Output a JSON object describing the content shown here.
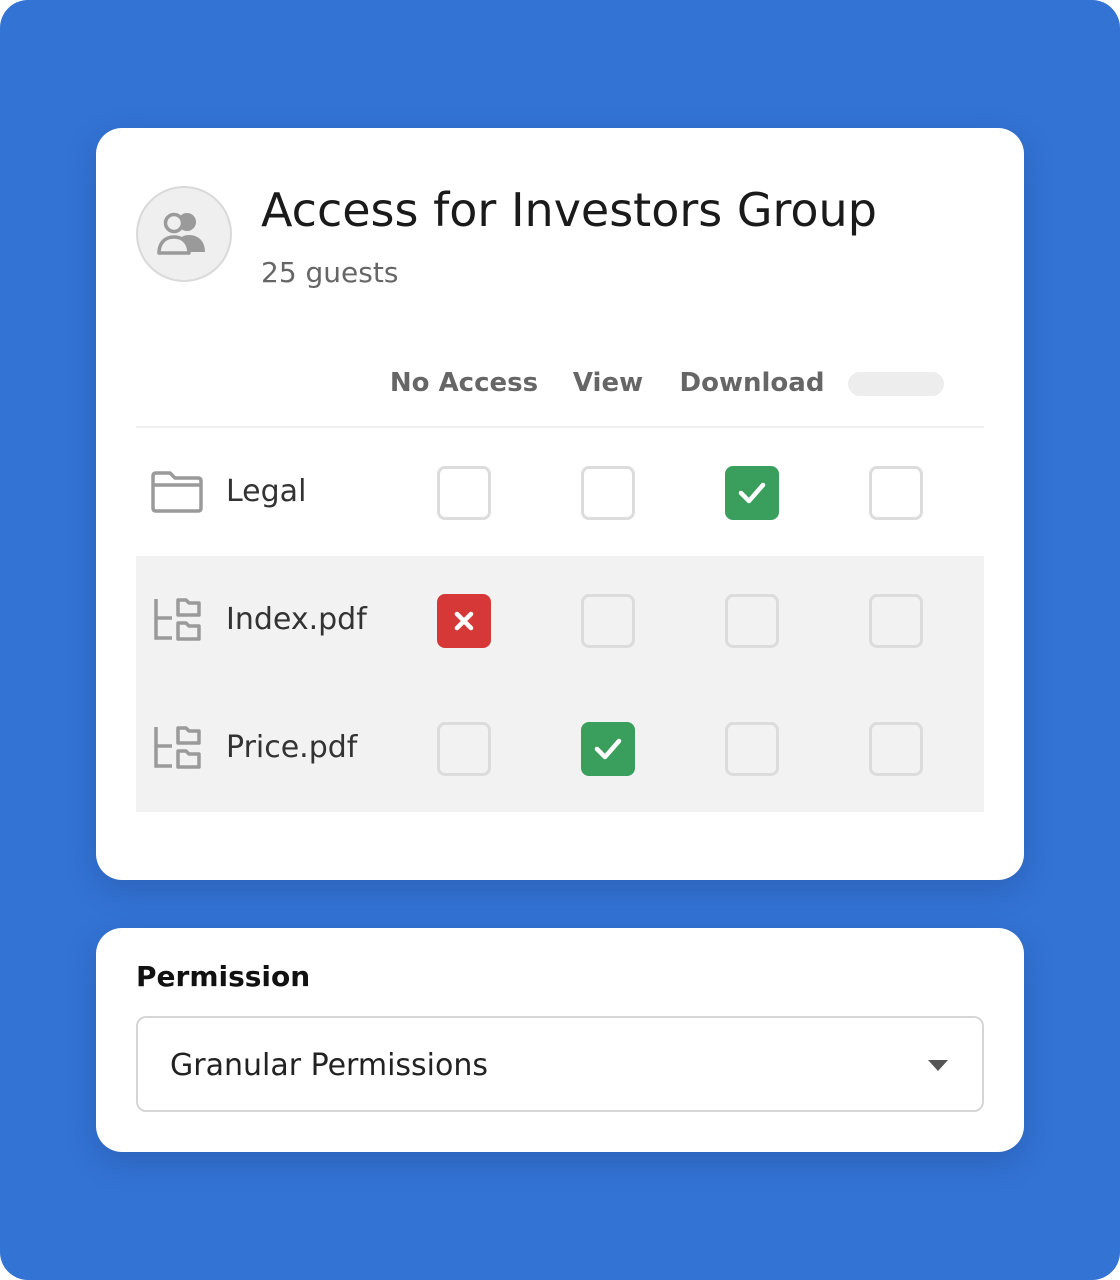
{
  "access_card": {
    "title": "Access for Investors Group",
    "guest_count": "25 guests",
    "avatar_icon": "users-group-icon",
    "columns": [
      "No Access",
      "View",
      "Download",
      ""
    ],
    "rows": [
      {
        "label": "Legal",
        "icon": "folder-icon",
        "states": [
          "off",
          "off",
          "on",
          "off"
        ]
      },
      {
        "label": "Index.pdf",
        "icon": "subfolder-tree-icon",
        "states": [
          "denied",
          "off",
          "off",
          "off"
        ]
      },
      {
        "label": "Price.pdf",
        "icon": "subfolder-tree-icon",
        "states": [
          "off",
          "on",
          "off",
          "off"
        ]
      }
    ]
  },
  "permission": {
    "label": "Permission",
    "selected": "Granular Permissions"
  },
  "colors": {
    "background": "#3373d4",
    "checked": "#3a9e5c",
    "denied": "#d63838"
  }
}
